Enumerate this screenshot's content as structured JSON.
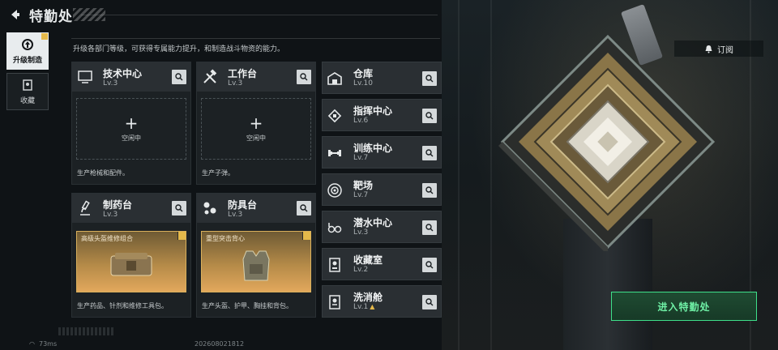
{
  "header": {
    "title": "特勤处"
  },
  "nav": [
    {
      "label": "升级制造",
      "active": true
    },
    {
      "label": "收藏",
      "active": false
    }
  ],
  "description": "升级各部门等级，可获得专属能力提升，和制造战斗物资的能力。",
  "cards": {
    "tech_center": {
      "name": "技术中心",
      "level": "Lv.3",
      "idle": "空闲中",
      "footer": "生产枪械和配件。"
    },
    "workbench": {
      "name": "工作台",
      "level": "Lv.3",
      "idle": "空闲中",
      "footer": "生产子弹。"
    },
    "pharmacy": {
      "name": "制药台",
      "level": "Lv.3",
      "craft": "高级头盔维修组合",
      "footer": "生产药品、针剂和维修工具包。"
    },
    "armory": {
      "name": "防具台",
      "level": "Lv.3",
      "craft": "重型突击背心",
      "footer": "生产头盔、护甲、胸挂和背包。"
    }
  },
  "small_cards": [
    {
      "name": "仓库",
      "level": "Lv.10",
      "icon": "warehouse-icon"
    },
    {
      "name": "指挥中心",
      "level": "Lv.6",
      "icon": "command-chip-icon"
    },
    {
      "name": "训练中心",
      "level": "Lv.7",
      "icon": "dumbbell-icon"
    },
    {
      "name": "靶场",
      "level": "Lv.7",
      "icon": "target-icon"
    },
    {
      "name": "潜水中心",
      "level": "Lv.3",
      "icon": "diving-mask-icon"
    },
    {
      "name": "收藏室",
      "level": "Lv.2",
      "icon": "collection-icon"
    },
    {
      "name": "洗消舱",
      "level": "Lv.1",
      "icon": "shower-icon"
    }
  ],
  "subscribe_label": "订阅",
  "enter_label": "进入特勤处",
  "footer": {
    "ping": "73ms",
    "uid": "20260802181​2"
  },
  "colors": {
    "accent_green": "#3ee08a",
    "gold": "#e5b94a"
  }
}
